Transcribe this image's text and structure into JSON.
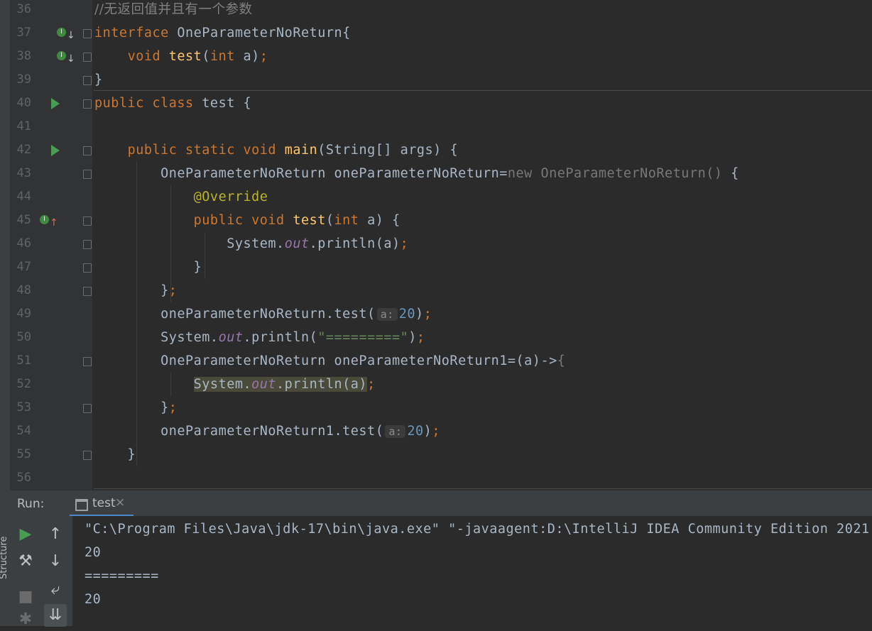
{
  "editor": {
    "lines": [
      {
        "num": "36",
        "segments": [
          {
            "t": "//无返回值并且有一个参数",
            "c": "cmt"
          }
        ]
      },
      {
        "num": "37",
        "segments": [
          {
            "t": "interface ",
            "c": "kw"
          },
          {
            "t": "OneParameterNoReturn{",
            "c": ""
          }
        ]
      },
      {
        "num": "38",
        "segments": [
          {
            "t": "    ",
            "c": ""
          },
          {
            "t": "void ",
            "c": "kw"
          },
          {
            "t": "test",
            "c": "fn"
          },
          {
            "t": "(",
            "c": ""
          },
          {
            "t": "int ",
            "c": "kw"
          },
          {
            "t": "a)",
            "c": ""
          },
          {
            "t": ";",
            "c": "kw"
          }
        ]
      },
      {
        "num": "39",
        "segments": [
          {
            "t": "}",
            "c": ""
          }
        ]
      },
      {
        "num": "40",
        "segments": [
          {
            "t": "public class ",
            "c": "kw"
          },
          {
            "t": "test {",
            "c": ""
          }
        ]
      },
      {
        "num": "41",
        "segments": []
      },
      {
        "num": "42",
        "segments": [
          {
            "t": "    ",
            "c": ""
          },
          {
            "t": "public static void ",
            "c": "kw"
          },
          {
            "t": "main",
            "c": "fn"
          },
          {
            "t": "(String[] args) {",
            "c": ""
          }
        ]
      },
      {
        "num": "43",
        "segments": [
          {
            "t": "        OneParameterNoReturn oneParameterNoReturn=",
            "c": ""
          },
          {
            "t": "new OneParameterNoReturn() ",
            "c": "dim"
          },
          {
            "t": "{",
            "c": ""
          }
        ]
      },
      {
        "num": "44",
        "segments": [
          {
            "t": "            ",
            "c": ""
          },
          {
            "t": "@Override",
            "c": "ann"
          }
        ]
      },
      {
        "num": "45",
        "segments": [
          {
            "t": "            ",
            "c": ""
          },
          {
            "t": "public void ",
            "c": "kw"
          },
          {
            "t": "test",
            "c": "fn"
          },
          {
            "t": "(",
            "c": ""
          },
          {
            "t": "int ",
            "c": "kw"
          },
          {
            "t": "a) {",
            "c": ""
          }
        ]
      },
      {
        "num": "46",
        "segments": [
          {
            "t": "                System.",
            "c": ""
          },
          {
            "t": "out",
            "c": "fld"
          },
          {
            "t": ".println(a)",
            "c": ""
          },
          {
            "t": ";",
            "c": "kw"
          }
        ]
      },
      {
        "num": "47",
        "segments": [
          {
            "t": "            }",
            "c": ""
          }
        ]
      },
      {
        "num": "48",
        "segments": [
          {
            "t": "        }",
            "c": ""
          },
          {
            "t": ";",
            "c": "kw"
          }
        ]
      },
      {
        "num": "49",
        "segments": [
          {
            "t": "        oneParameterNoReturn.test(",
            "c": ""
          },
          {
            "t": "a:",
            "c": "hint"
          },
          {
            "t": "20",
            "c": "num"
          },
          {
            "t": ")",
            "c": ""
          },
          {
            "t": ";",
            "c": "kw"
          }
        ]
      },
      {
        "num": "50",
        "segments": [
          {
            "t": "        System.",
            "c": ""
          },
          {
            "t": "out",
            "c": "fld"
          },
          {
            "t": ".println(",
            "c": ""
          },
          {
            "t": "\"=========\"",
            "c": "str"
          },
          {
            "t": ")",
            "c": ""
          },
          {
            "t": ";",
            "c": "kw"
          }
        ]
      },
      {
        "num": "51",
        "segments": [
          {
            "t": "        OneParameterNoReturn oneParameterNoReturn1=(a)->",
            "c": ""
          },
          {
            "t": "{",
            "c": "dim"
          }
        ]
      },
      {
        "num": "52",
        "segments": [
          {
            "t": "            ",
            "c": ""
          },
          {
            "t": "System.",
            "c": "hl"
          },
          {
            "t": "out",
            "c": "fld hl"
          },
          {
            "t": ".println(a)",
            "c": "hl"
          },
          {
            "t": ";",
            "c": "kw"
          }
        ]
      },
      {
        "num": "53",
        "segments": [
          {
            "t": "        }",
            "c": ""
          },
          {
            "t": ";",
            "c": "kw"
          }
        ]
      },
      {
        "num": "54",
        "segments": [
          {
            "t": "        oneParameterNoReturn1.test(",
            "c": ""
          },
          {
            "t": "a:",
            "c": "hint"
          },
          {
            "t": "20",
            "c": "num"
          },
          {
            "t": ")",
            "c": ""
          },
          {
            "t": ";",
            "c": "kw"
          }
        ]
      },
      {
        "num": "55",
        "segments": [
          {
            "t": "    }",
            "c": ""
          }
        ]
      },
      {
        "num": "56",
        "segments": []
      }
    ]
  },
  "run_panel": {
    "label": "Run:",
    "tab_label": "test",
    "tab_close": "×",
    "structure_label": "Structure",
    "console_lines": [
      "\"C:\\Program Files\\Java\\jdk-17\\bin\\java.exe\" \"-javaagent:D:\\IntelliJ IDEA Community Edition 2021",
      "20",
      "=========",
      "20"
    ]
  }
}
